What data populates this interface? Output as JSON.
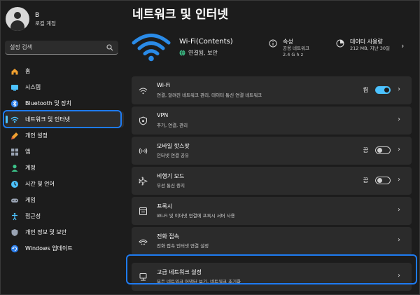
{
  "profile": {
    "name": "B",
    "account": "로컬 계정"
  },
  "search": {
    "placeholder": "설정 검색"
  },
  "nav": [
    {
      "label": "홈",
      "icon": "home-icon"
    },
    {
      "label": "시스템",
      "icon": "system-icon"
    },
    {
      "label": "Bluetooth 및 장치",
      "icon": "bluetooth-icon"
    },
    {
      "label": "네트워크 및 인터넷",
      "icon": "network-icon",
      "active": true
    },
    {
      "label": "개인 설정",
      "icon": "brush-icon"
    },
    {
      "label": "앱",
      "icon": "apps-icon"
    },
    {
      "label": "계정",
      "icon": "account-icon"
    },
    {
      "label": "시간 및 언어",
      "icon": "time-language-icon"
    },
    {
      "label": "게임",
      "icon": "gaming-icon"
    },
    {
      "label": "접근성",
      "icon": "accessibility-icon"
    },
    {
      "label": "개인 정보 및 보안",
      "icon": "shield-icon"
    },
    {
      "label": "Windows 업데이트",
      "icon": "update-icon"
    }
  ],
  "page": {
    "title": "네트워크 및 인터넷"
  },
  "hero": {
    "ssid": "Wi-Fi(Contents)",
    "status": "연결됨, 보안",
    "properties": {
      "title": "속성",
      "line1": "공용 네트워크",
      "line2": "2.4 G h z"
    },
    "data_usage": {
      "title": "데이터 사용량",
      "detail": "212 MB, 지난 30일"
    }
  },
  "rows": [
    {
      "title": "Wi-Fi",
      "subtitle": "연결, 알려진 네트워크 관리, 데이터 통신 연결 네트워크",
      "icon": "wifi-icon",
      "toggle": "on",
      "toggle_label": "켬"
    },
    {
      "title": "VPN",
      "subtitle": "추가, 연결, 관리",
      "icon": "vpn-shield-icon"
    },
    {
      "title": "모바일 핫스팟",
      "subtitle": "인터넷 연결 공유",
      "icon": "hotspot-icon",
      "toggle": "off",
      "toggle_label": "끔"
    },
    {
      "title": "비행기 모드",
      "subtitle": "무선 통신 중지",
      "icon": "airplane-icon",
      "toggle": "off",
      "toggle_label": "끔"
    },
    {
      "title": "프록시",
      "subtitle": "Wi-Fi 및 이더넷 연결에 프록시 서버 사용",
      "icon": "proxy-icon"
    },
    {
      "title": "전화 접속",
      "subtitle": "전화 접속 인터넷 연결 설정",
      "icon": "dialup-icon"
    },
    {
      "title": "고급 네트워크 설정",
      "subtitle": "모든 네트워크 어댑터 보기, 네트워크 초기화",
      "icon": "advanced-network-icon"
    }
  ],
  "colors": {
    "accent": "#4cc2ff",
    "highlight": "#1e7bf2",
    "background": "#1c1c1c",
    "card": "#2b2b2b"
  }
}
